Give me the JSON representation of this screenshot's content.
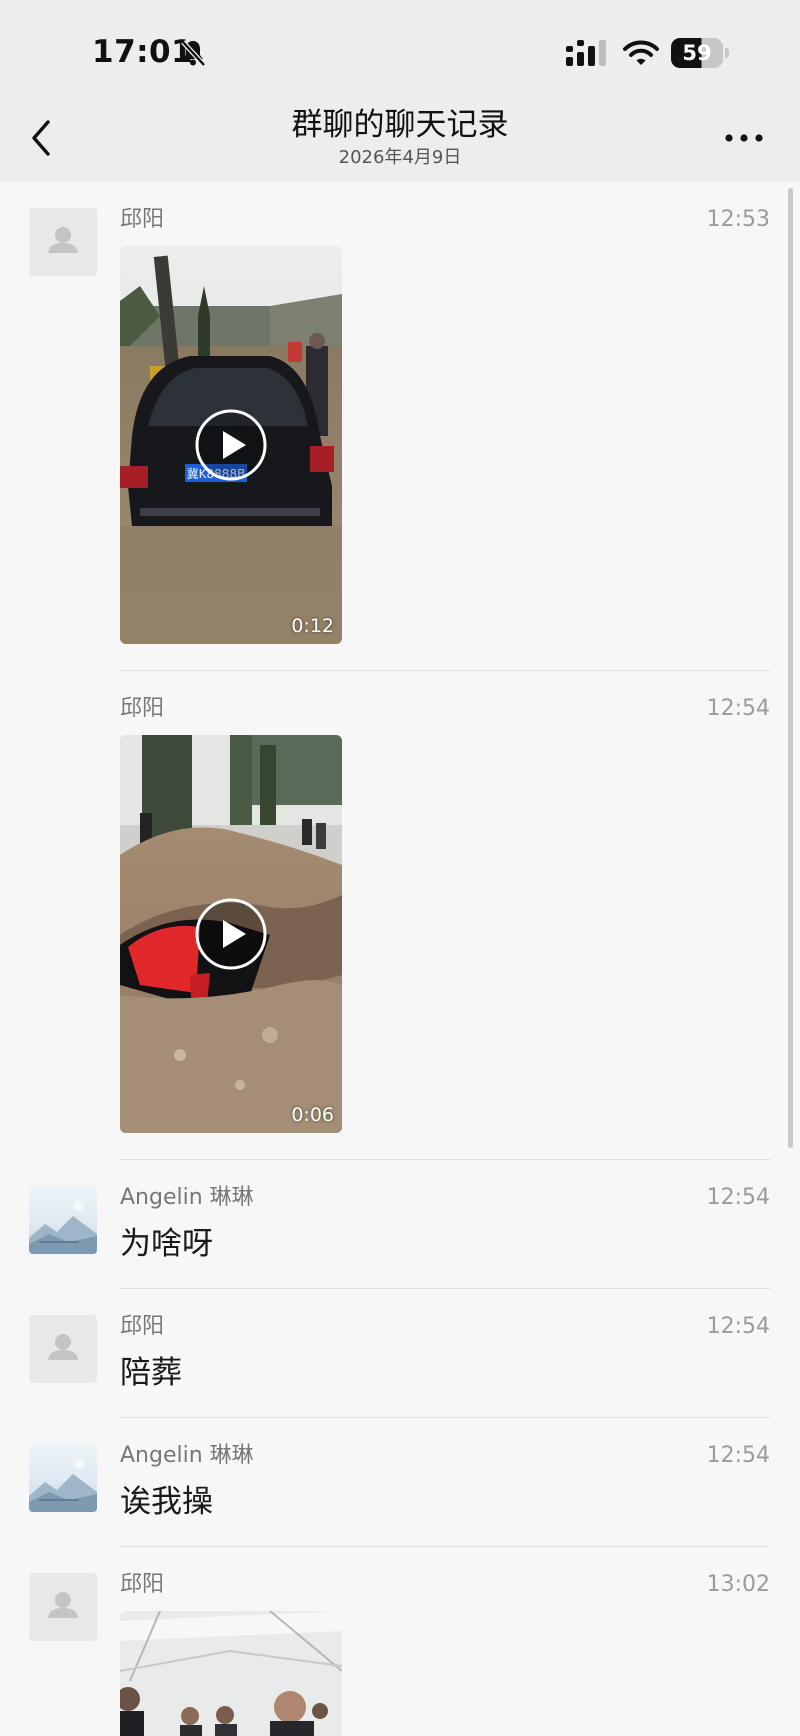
{
  "status_bar": {
    "time": "17:01",
    "bell_icon": "bell-slash-icon",
    "battery_level": "59"
  },
  "nav": {
    "title": "群聊的聊天记录",
    "subtitle": "2026年4月9日",
    "back_icon": "chevron-left-icon",
    "more_icon": "ellipsis-icon"
  },
  "messages": [
    {
      "sender": "邱阳",
      "time": "12:53",
      "type": "video",
      "duration": "0:12",
      "plate": "冀K8888B"
    },
    {
      "sender": "邱阳",
      "time": "12:54",
      "type": "video",
      "duration": "0:06"
    },
    {
      "sender": "Angelin 琳琳",
      "time": "12:54",
      "type": "text",
      "text": "为啥呀"
    },
    {
      "sender": "邱阳",
      "time": "12:54",
      "type": "text",
      "text": "陪葬"
    },
    {
      "sender": "Angelin 琳琳",
      "time": "12:54",
      "type": "text",
      "text": "诶我操"
    },
    {
      "sender": "邱阳",
      "time": "13:02",
      "type": "image"
    }
  ],
  "colors": {
    "header_bg": "#ededed",
    "list_bg": "#f7f7f7",
    "name_text": "#777777",
    "time_text": "#9b9b9b"
  }
}
